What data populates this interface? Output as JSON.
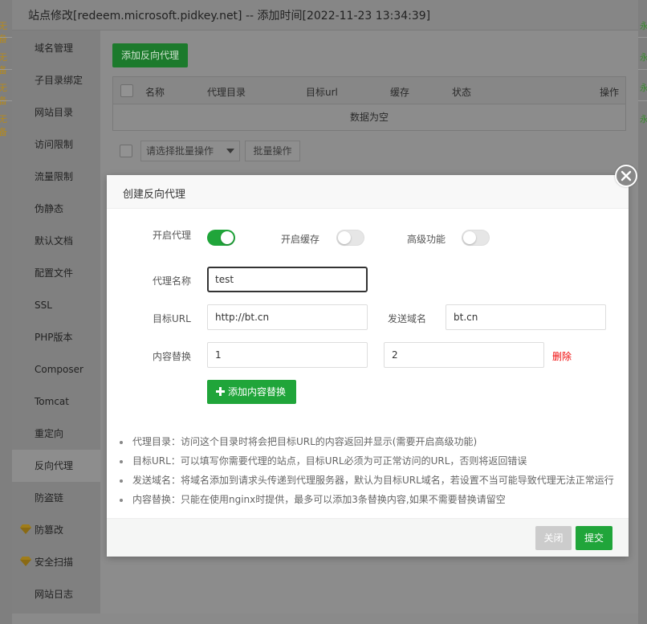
{
  "background": {
    "left_fragments": [
      "无备",
      "无备",
      "无备",
      "无备"
    ],
    "right_fragments": [
      "永",
      "永",
      "永",
      "永"
    ]
  },
  "window": {
    "title": "站点修改[redeem.microsoft.pidkey.net] -- 添加时间[2022-11-23 13:34:39]"
  },
  "sidebar": {
    "items": [
      {
        "label": "域名管理"
      },
      {
        "label": "子目录绑定"
      },
      {
        "label": "网站目录"
      },
      {
        "label": "访问限制"
      },
      {
        "label": "流量限制"
      },
      {
        "label": "伪静态"
      },
      {
        "label": "默认文档"
      },
      {
        "label": "配置文件"
      },
      {
        "label": "SSL"
      },
      {
        "label": "PHP版本"
      },
      {
        "label": "Composer"
      },
      {
        "label": "Tomcat"
      },
      {
        "label": "重定向"
      },
      {
        "label": "反向代理",
        "active": true
      },
      {
        "label": "防盗链"
      },
      {
        "label": "防篡改",
        "icon": "diamond-icon"
      },
      {
        "label": "安全扫描",
        "icon": "diamond-icon"
      },
      {
        "label": "网站日志"
      }
    ]
  },
  "content": {
    "add_button": "添加反向代理",
    "table": {
      "columns": [
        "名称",
        "代理目录",
        "目标url",
        "缓存",
        "状态",
        "操作"
      ],
      "empty_text": "数据为空"
    },
    "batch_select_placeholder": "请选择批量操作",
    "batch_button": "批量操作"
  },
  "modal": {
    "title": "创建反向代理",
    "toggles": {
      "enable_proxy": {
        "label": "开启代理",
        "on": true
      },
      "enable_cache": {
        "label": "开启缓存",
        "on": false
      },
      "advanced": {
        "label": "高级功能",
        "on": false
      }
    },
    "proxy_name": {
      "label": "代理名称",
      "value": "test"
    },
    "target_url": {
      "label": "目标URL",
      "value": "http://bt.cn"
    },
    "send_domain": {
      "label": "发送域名",
      "value": "bt.cn"
    },
    "content_replace": {
      "label": "内容替换",
      "value1": "1",
      "value2": "2",
      "delete_label": "删除"
    },
    "add_replace_button": "添加内容替换",
    "tips": [
      "代理目录：访问这个目录时将会把目标URL的内容返回并显示(需要开启高级功能)",
      "目标URL：可以填写你需要代理的站点，目标URL必须为可正常访问的URL，否则将返回错误",
      "发送域名：将域名添加到请求头传递到代理服务器，默认为目标URL域名，若设置不当可能导致代理无法正常运行",
      "内容替换：只能在使用nginx时提供，最多可以添加3条替换内容,如果不需要替换请留空"
    ],
    "close_button": "关闭",
    "submit_button": "提交"
  },
  "colors": {
    "accent_green": "#20a53a",
    "danger_red": "#ef0808",
    "diamond_gold": "#d9a21f"
  }
}
